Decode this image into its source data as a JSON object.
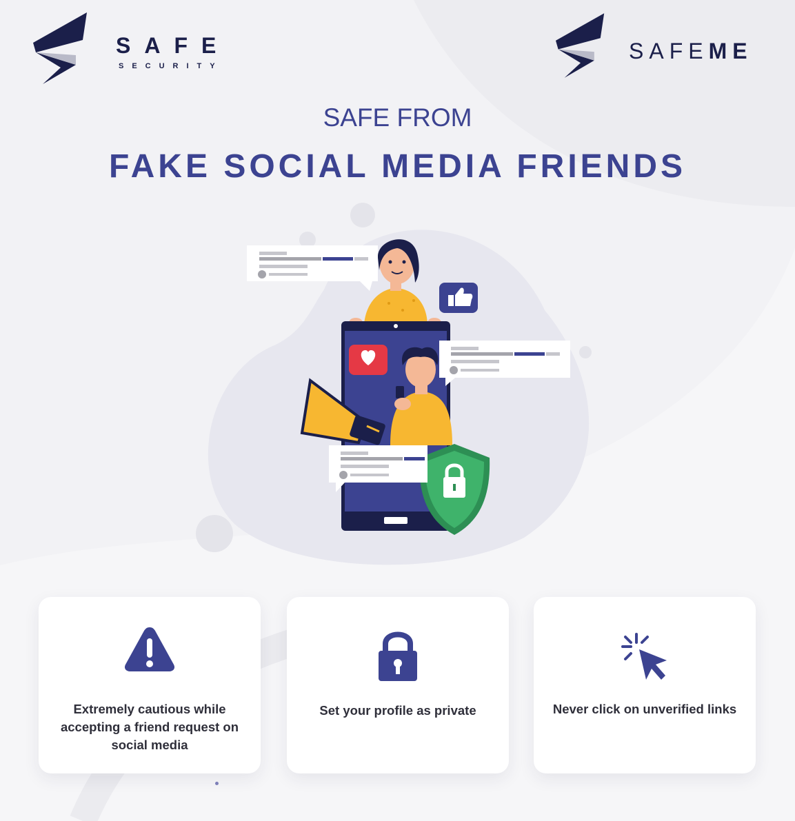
{
  "brand": {
    "left": {
      "name": "SAFE",
      "sub": "SECURITY"
    },
    "right": {
      "name_a": "SAFE",
      "name_b": "ME"
    }
  },
  "header": {
    "pre_title": "SAFE FROM",
    "title": "FAKE SOCIAL MEDIA FRIENDS"
  },
  "tips": [
    {
      "icon": "warning-icon",
      "text": "Extremely cautious while accepting a friend request on social media"
    },
    {
      "icon": "padlock-icon",
      "text": "Set your profile as private"
    },
    {
      "icon": "cursor-click-icon",
      "text": "Never click on unverified links"
    }
  ],
  "colors": {
    "primary": "#3c4391",
    "dark": "#1b1f4a",
    "accent_yellow": "#f7b731",
    "accent_red": "#e53945",
    "accent_green": "#3fb36b",
    "background": "#f2f2f5"
  }
}
